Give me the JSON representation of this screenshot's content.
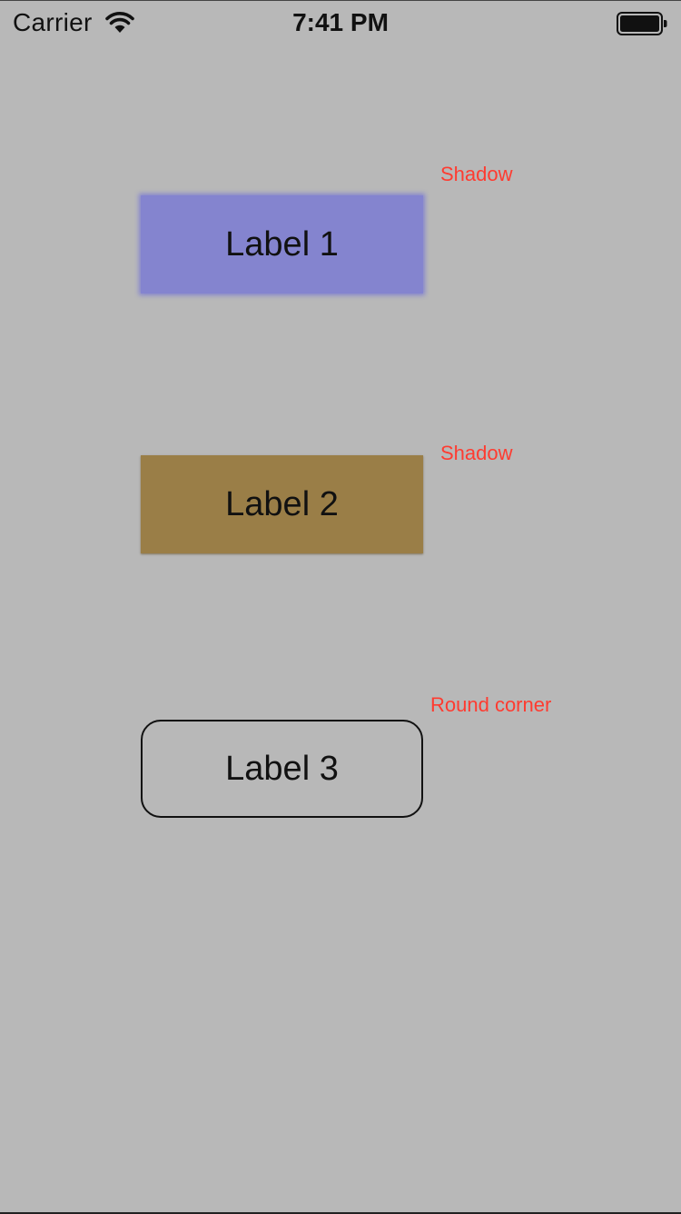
{
  "status_bar": {
    "carrier": "Carrier",
    "time": "7:41 PM",
    "wifi_icon": "wifi-icon",
    "battery_icon": "battery-full-icon",
    "battery_level": 1.0
  },
  "labels": [
    {
      "text": "Label 1",
      "annotation": "Shadow",
      "color": "#8484cf"
    },
    {
      "text": "Label 2",
      "annotation": "Shadow",
      "color": "#9a7e47"
    },
    {
      "text": "Label 3",
      "annotation": "Round corner",
      "color": "transparent"
    }
  ],
  "colors": {
    "background": "#b8b8b8",
    "annotation": "#ff3b30",
    "text": "#111111"
  }
}
